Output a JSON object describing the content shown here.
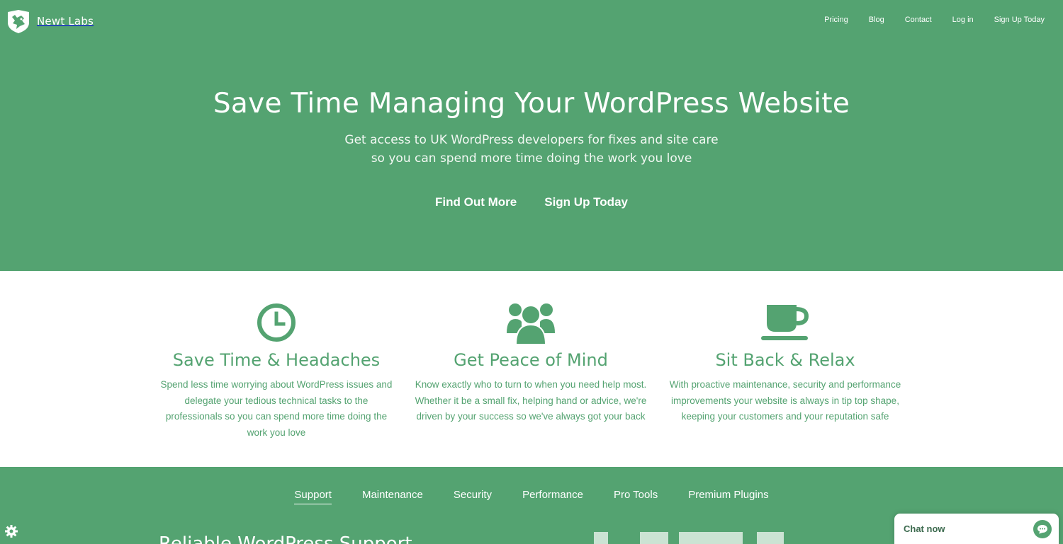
{
  "brand": {
    "name": "Newt Labs"
  },
  "nav": {
    "items": [
      {
        "label": "Pricing"
      },
      {
        "label": "Blog"
      },
      {
        "label": "Contact"
      },
      {
        "label": "Log in"
      },
      {
        "label": "Sign Up Today"
      }
    ]
  },
  "hero": {
    "title": "Save Time Managing Your WordPress Website",
    "subtitle_line1": "Get access to UK WordPress developers for fixes and site care",
    "subtitle_line2": "so you can spend more time doing the work you love",
    "cta_primary": "Find Out More",
    "cta_secondary": "Sign Up Today"
  },
  "features": [
    {
      "icon": "clock-icon",
      "title": "Save Time & Headaches",
      "text": "Spend less time worrying about WordPress issues and delegate your tedious technical tasks to the professionals so you can spend more time doing the work you love"
    },
    {
      "icon": "people-icon",
      "title": "Get Peace of Mind",
      "text": "Know exactly who to turn to when you need help most. Whether it be a small fix, helping hand or advice, we're driven by your success so we've always got your back"
    },
    {
      "icon": "coffee-cup-icon",
      "title": "Sit Back & Relax",
      "text": "With proactive maintenance, security and performance improvements your website is always in tip top shape, keeping your customers and your reputation safe"
    }
  ],
  "service_tabs": {
    "items": [
      {
        "label": "Support",
        "active": true
      },
      {
        "label": "Maintenance",
        "active": false
      },
      {
        "label": "Security",
        "active": false
      },
      {
        "label": "Performance",
        "active": false
      },
      {
        "label": "Pro Tools",
        "active": false
      },
      {
        "label": "Premium Plugins",
        "active": false
      }
    ],
    "section_heading": "Reliable WordPress Support"
  },
  "chat": {
    "label": "Chat now"
  },
  "colors": {
    "brand_green": "#54a371",
    "white": "#ffffff",
    "chat_text": "#3d6b4f"
  }
}
